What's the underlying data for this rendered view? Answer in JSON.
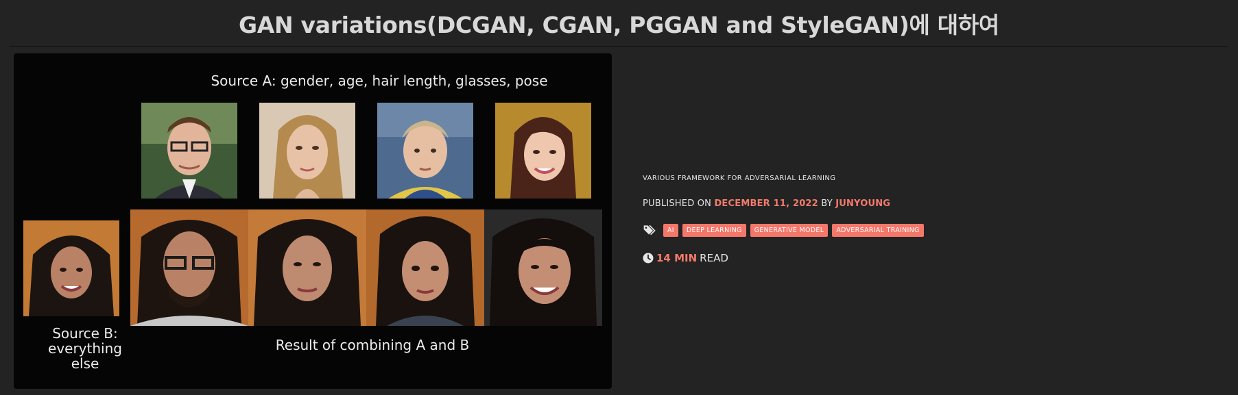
{
  "page": {
    "title": "GAN variations(DCGAN, CGAN, PGGAN and StyleGAN)에 대하여"
  },
  "hero": {
    "caption_source_a": "Source A: gender, age, hair length, glasses, pose",
    "caption_source_b": "Source B: everything else",
    "caption_result": "Result of combining A and B",
    "caption_source_b_lines": [
      "Source B:",
      "everything",
      "else"
    ]
  },
  "post_meta": {
    "subtitle": "VARIOUS FRAMEWORK FOR ADVERSARIAL LEARNING",
    "published_prefix": "PUBLISHED ON",
    "published_date": "DECEMBER 11, 2022",
    "by_label": "BY",
    "author": "JUNYOUNG",
    "tags": [
      "AI",
      "DEEP LEARNING",
      "GENERATIVE MODEL",
      "ADVERSARIAL TRAINING"
    ],
    "read_time_value": "14 MIN",
    "read_time_suffix": "READ",
    "icons": {
      "tags": "tags-icon",
      "clock": "clock-icon"
    },
    "accent_color": "#f57b6b"
  }
}
